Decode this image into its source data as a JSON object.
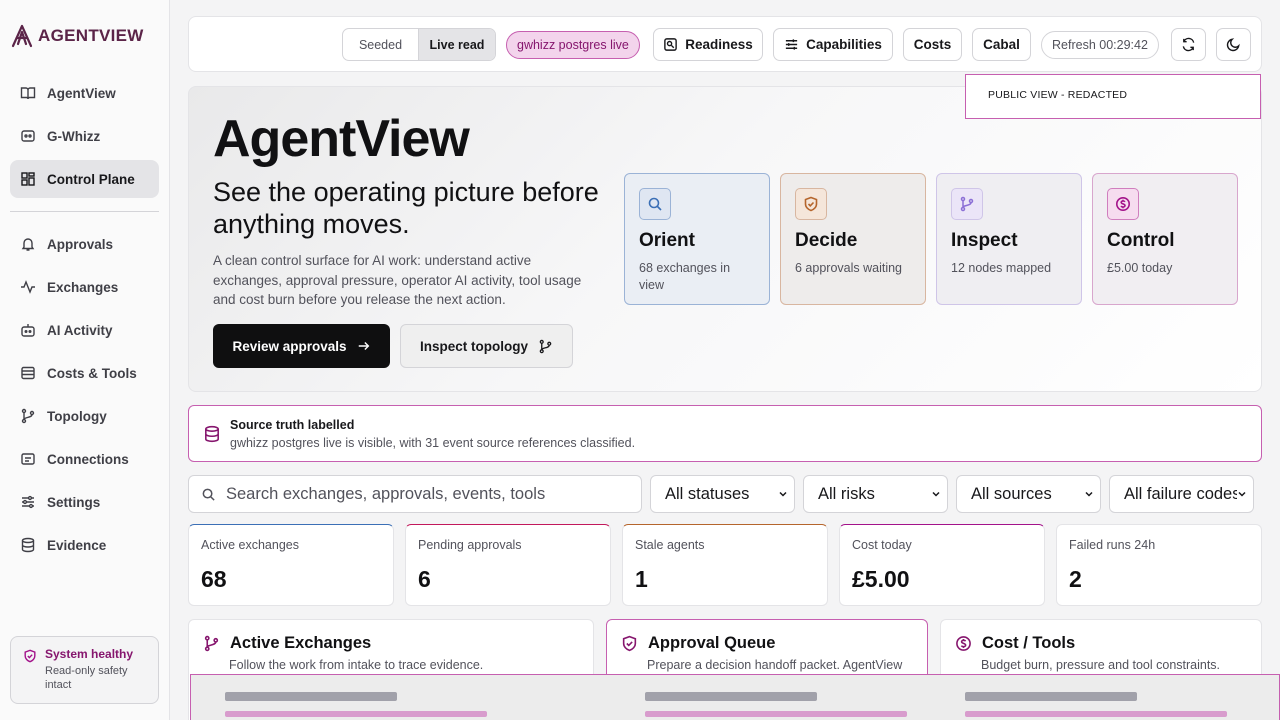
{
  "brand": {
    "name": "AGENTVIEW",
    "accent": "#86166e"
  },
  "sidebar": {
    "items": [
      {
        "label": "AgentView",
        "icon": "book-icon"
      },
      {
        "label": "G-Whizz",
        "icon": "bot-icon"
      },
      {
        "label": "Control Plane",
        "icon": "grid-icon",
        "active": true
      },
      {
        "label": "Approvals",
        "icon": "bell-icon"
      },
      {
        "label": "Exchanges",
        "icon": "activity-icon"
      },
      {
        "label": "AI Activity",
        "icon": "bot-icon"
      },
      {
        "label": "Costs & Tools",
        "icon": "wallet-icon"
      },
      {
        "label": "Topology",
        "icon": "branch-icon"
      },
      {
        "label": "Connections",
        "icon": "plug-icon"
      },
      {
        "label": "Settings",
        "icon": "sliders-icon"
      },
      {
        "label": "Evidence",
        "icon": "database-icon"
      }
    ],
    "health": {
      "title": "System healthy",
      "subtitle": "Read-only safety intact"
    }
  },
  "topbar": {
    "mode_seeded": "Seeded",
    "mode_live": "Live read",
    "source_pill": "gwhizz postgres live",
    "readiness": "Readiness",
    "capabilities": "Capabilities",
    "costs": "Costs",
    "cabal": "Cabal",
    "refresh": "Refresh 00:29:42"
  },
  "redaction_notice": "PUBLIC VIEW - REDACTED",
  "hero": {
    "title": "AgentView",
    "subtitle": "See the operating picture before anything moves.",
    "description": "A clean control surface for AI work: understand active exchanges, approval pressure, operator AI activity, tool usage and cost burn before you release the next action.",
    "primary_cta": "Review approvals",
    "secondary_cta": "Inspect topology",
    "cards": [
      {
        "title": "Orient",
        "subtitle": "68 exchanges in view",
        "icon": "search-icon",
        "color": "#3b6fb6"
      },
      {
        "title": "Decide",
        "subtitle": "6 approvals waiting",
        "icon": "shield-icon",
        "color": "#b5652c"
      },
      {
        "title": "Inspect",
        "subtitle": "12 nodes mapped",
        "icon": "branch-icon",
        "color": "#8b6fd6"
      },
      {
        "title": "Control",
        "subtitle": "£5.00 today",
        "icon": "dollar-icon",
        "color": "#a3128a"
      }
    ]
  },
  "banner": {
    "title": "Source truth labelled",
    "subtitle": "gwhizz postgres live is visible, with 31 event source references classified."
  },
  "filters": {
    "search_placeholder": "Search exchanges, approvals, events, tools",
    "status": "All statuses",
    "risk": "All risks",
    "source": "All sources",
    "failure": "All failure codes"
  },
  "stats": [
    {
      "label": "Active exchanges",
      "value": "68",
      "accent": "#3b6fb6"
    },
    {
      "label": "Pending approvals",
      "value": "6",
      "accent": "#c2185b"
    },
    {
      "label": "Stale agents",
      "value": "1",
      "accent": "#b5652c"
    },
    {
      "label": "Cost today",
      "value": "£5.00",
      "accent": "#a3128a"
    },
    {
      "label": "Failed runs 24h",
      "value": "2",
      "accent": "#e4e4e7"
    }
  ],
  "panels": [
    {
      "title": "Active Exchanges",
      "subtitle": "Follow the work from intake to trace evidence.",
      "icon": "branch-icon"
    },
    {
      "title": "Approval Queue",
      "subtitle": "Prepare a decision handoff packet. AgentView",
      "icon": "shield-icon"
    },
    {
      "title": "Cost / Tools",
      "subtitle": "Budget burn, pressure and tool constraints.",
      "icon": "dollar-icon"
    }
  ]
}
